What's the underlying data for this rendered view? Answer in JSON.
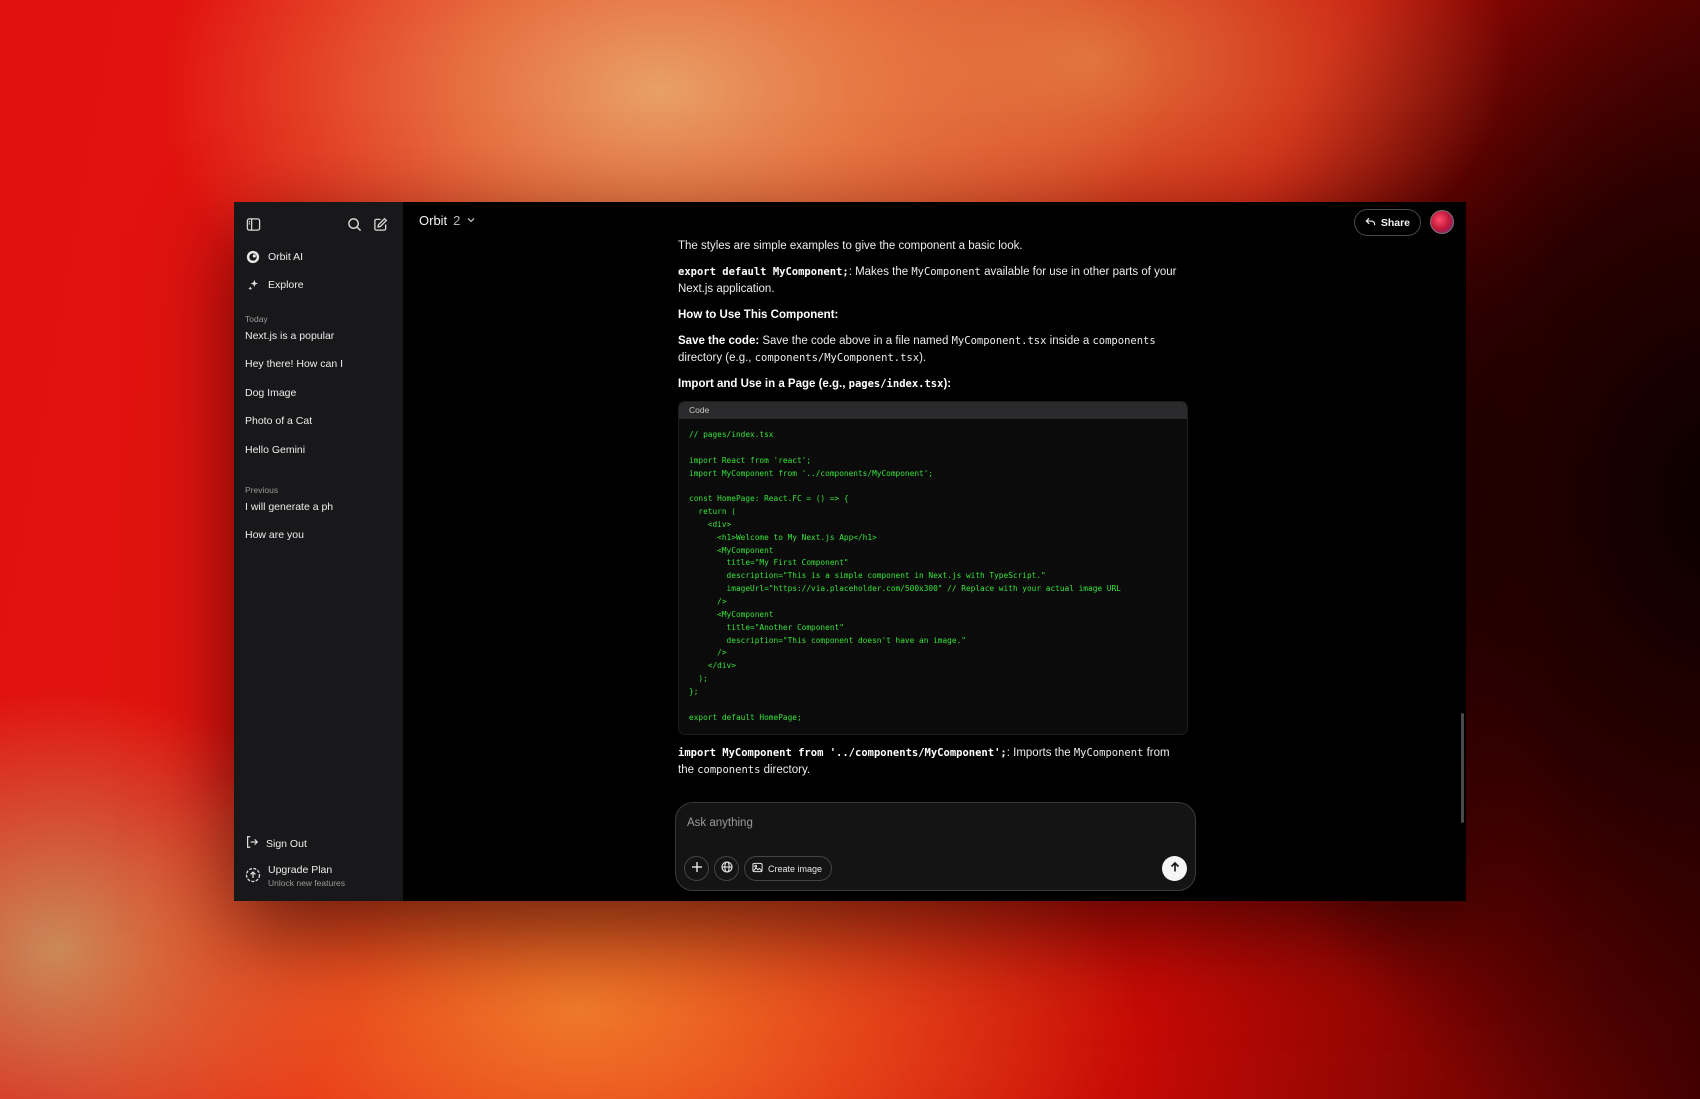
{
  "sidebar": {
    "nav": [
      {
        "label": "Orbit AI",
        "icon": "orbit-logo-icon"
      },
      {
        "label": "Explore",
        "icon": "sparkle-icon"
      }
    ],
    "today_label": "Today",
    "today": [
      "Next.js is a popular",
      "Hey there! How can I",
      "Dog Image",
      "Photo of a Cat",
      "Hello Gemini"
    ],
    "previous_label": "Previous",
    "previous": [
      "I will generate a ph",
      "How are you"
    ],
    "sign_out": "Sign Out",
    "upgrade_title": "Upgrade Plan",
    "upgrade_sub": "Unlock new features"
  },
  "header": {
    "model_name": "Orbit",
    "model_version": "2",
    "share_label": "Share"
  },
  "message": {
    "p1": "The styles are simple examples to give the component a basic look.",
    "p2_code": "export default MyComponent;",
    "p2_a": ": Makes the ",
    "p2_code2": "MyComponent",
    "p2_b": " available for use in other parts of your Next.js application.",
    "h_use": "How to Use This Component:",
    "p3_bold": "Save the code:",
    "p3_a": " Save the code above in a file named ",
    "p3_code1": "MyComponent.tsx",
    "p3_b": " inside a ",
    "p3_code2": "components",
    "p3_c": " directory (e.g., ",
    "p3_code3": "components/MyComponent.tsx",
    "p3_d": ").",
    "h_import_a": "Import and Use in a Page (e.g., ",
    "h_import_code": "pages/index.tsx",
    "h_import_b": "):",
    "code_label": "Code",
    "code": "// pages/index.tsx\n\nimport React from 'react';\nimport MyComponent from '../components/MyComponent';\n\nconst HomePage: React.FC = () => {\n  return (\n    <div>\n      <h1>Welcome to My Next.js App</h1>\n      <MyComponent\n        title=\"My First Component\"\n        description=\"This is a simple component in Next.js with TypeScript.\"\n        imageUrl=\"https://via.placeholder.com/500x300\" // Replace with your actual image URL\n      />\n      <MyComponent\n        title=\"Another Component\"\n        description=\"This component doesn't have an image.\"\n      />\n    </div>\n  );\n};\n\nexport default HomePage;",
    "p4_code": "import MyComponent from '../components/MyComponent';",
    "p4_a": ": Imports the ",
    "p4_code2": "MyComponent",
    "p4_b": " from the ",
    "p4_code3": "components",
    "p4_c": " directory."
  },
  "composer": {
    "placeholder": "Ask anything",
    "create_image": "Create image"
  }
}
